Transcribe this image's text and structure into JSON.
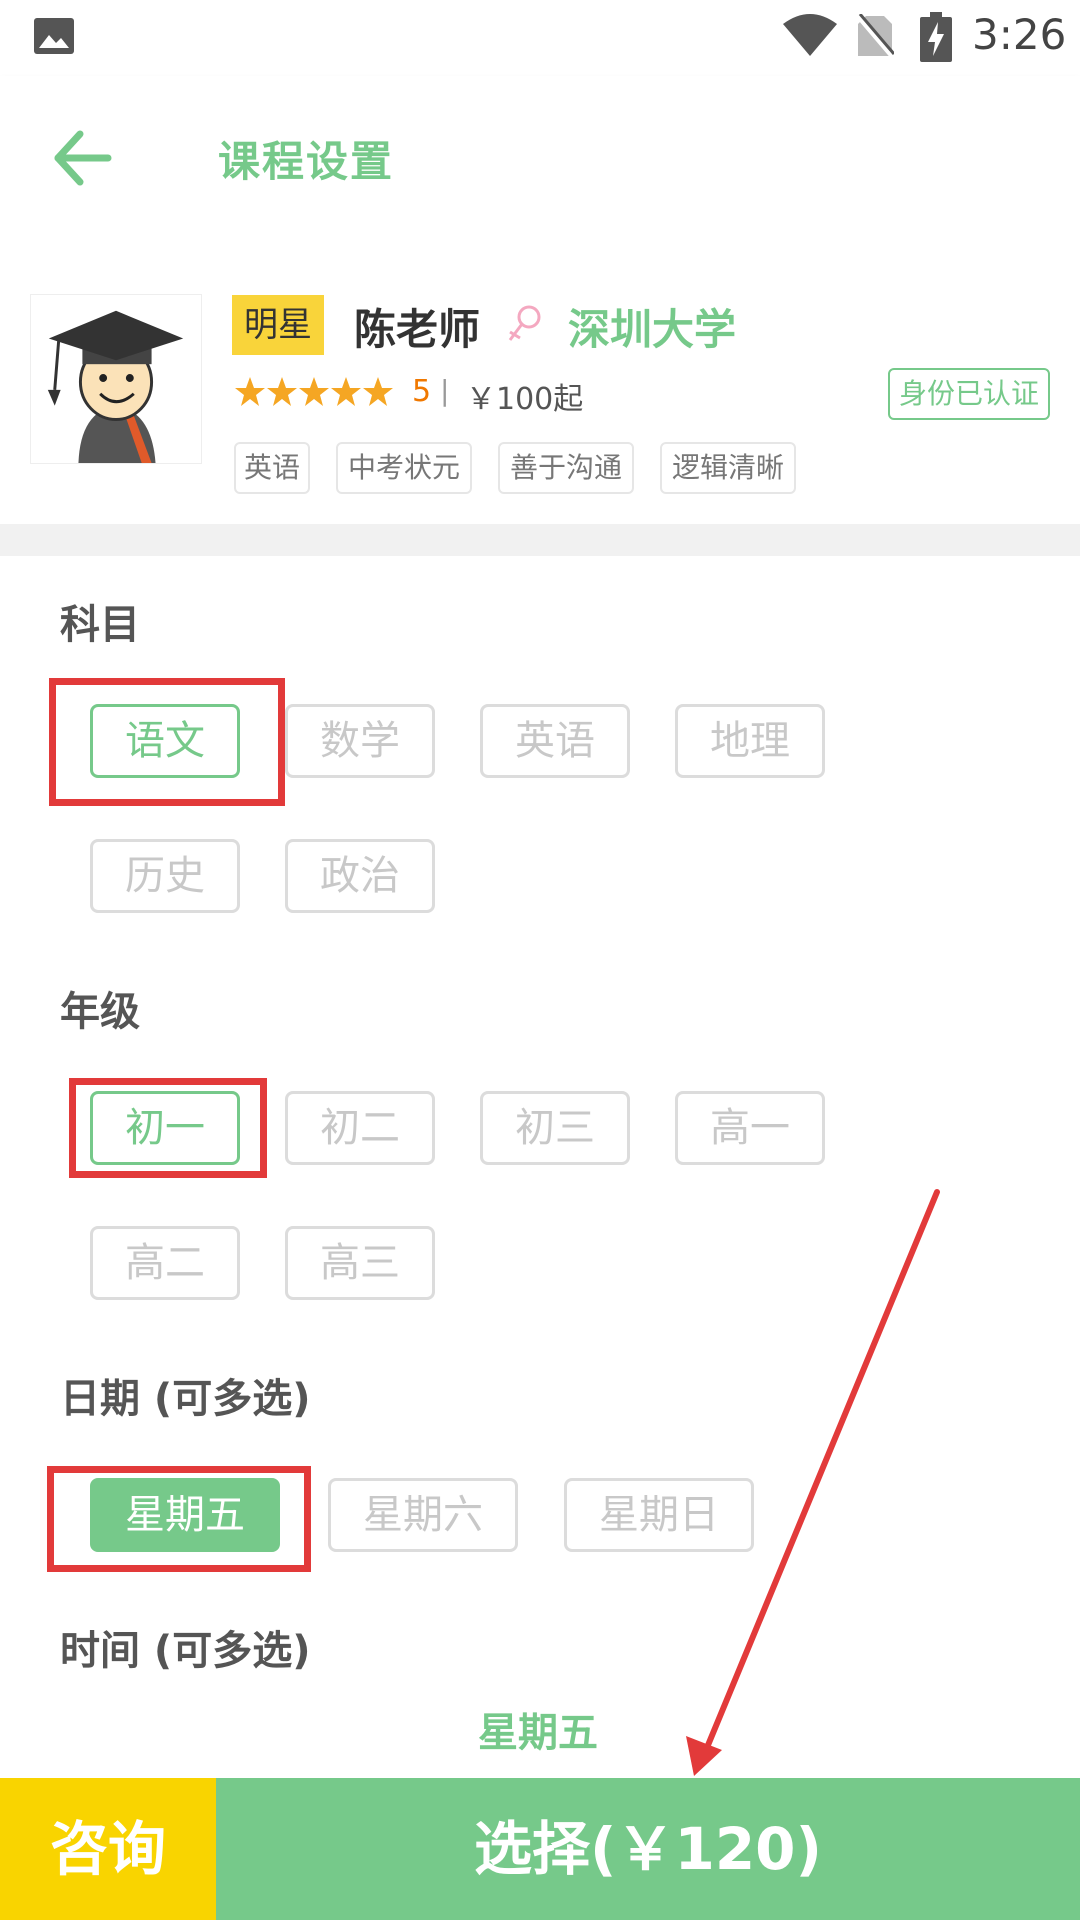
{
  "status_bar": {
    "time": "3:26"
  },
  "header": {
    "title": "课程设置"
  },
  "teacher": {
    "badge": "明星",
    "name": "陈老师",
    "university": "深圳大学",
    "rating": "5",
    "rating_separator": "|",
    "price_from": "￥100起",
    "verified": "身份已认证",
    "tags": [
      "英语",
      "中考状元",
      "善于沟通",
      "逻辑清晰"
    ]
  },
  "subject": {
    "title": "科目",
    "options": [
      "语文",
      "数学",
      "英语",
      "地理",
      "历史",
      "政治"
    ],
    "selected": "语文"
  },
  "grade": {
    "title": "年级",
    "options": [
      "初一",
      "初二",
      "初三",
      "高一",
      "高二",
      "高三"
    ],
    "selected": "初一"
  },
  "date": {
    "title": "日期 (可多选)",
    "options": [
      "星期五",
      "星期六",
      "星期日"
    ],
    "selected": "星期五"
  },
  "time": {
    "title": "时间 (可多选)",
    "day_label": "星期五"
  },
  "bottom": {
    "consult": "咨询",
    "select": "选择(￥120)"
  },
  "colors": {
    "accent_green": "#76c98a",
    "consult_yellow": "#f9d400",
    "badge_yellow": "#f9d43a",
    "highlight_red": "#e23a3a",
    "rating_orange": "#f07800"
  }
}
